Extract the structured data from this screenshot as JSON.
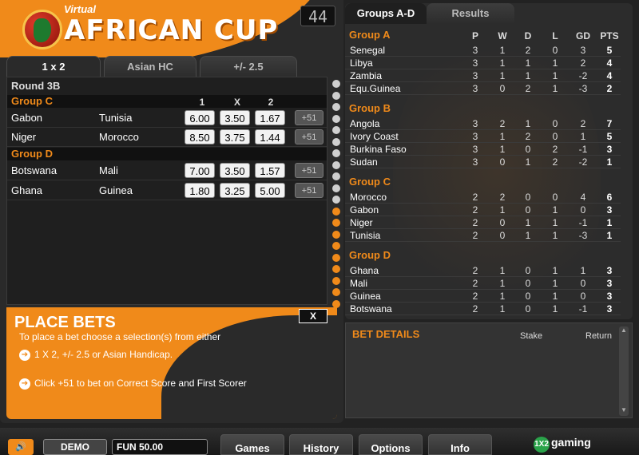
{
  "header": {
    "virtual": "Virtual",
    "title": "AFRICAN CUP",
    "round_counter": "44"
  },
  "tabs_left": [
    {
      "label": "1 x 2",
      "active": true
    },
    {
      "label": "Asian HC",
      "active": false
    },
    {
      "label": "+/- 2.5",
      "active": false
    }
  ],
  "market": {
    "round": "Round 3B",
    "columns": [
      "1",
      "X",
      "2"
    ],
    "plus_label": "+51",
    "groups": [
      {
        "name": "Group C",
        "matches": [
          {
            "home": "Gabon",
            "away": "Tunisia",
            "o1": "6.00",
            "ox": "3.50",
            "o2": "1.67"
          },
          {
            "home": "Niger",
            "away": "Morocco",
            "o1": "8.50",
            "ox": "3.75",
            "o2": "1.44"
          }
        ]
      },
      {
        "name": "Group D",
        "matches": [
          {
            "home": "Botswana",
            "away": "Mali",
            "o1": "7.00",
            "ox": "3.50",
            "o2": "1.57"
          },
          {
            "home": "Ghana",
            "away": "Guinea",
            "o1": "1.80",
            "ox": "3.25",
            "o2": "5.00"
          }
        ]
      }
    ]
  },
  "place_bets": {
    "title": "PLACE BETS",
    "intro": "To place a bet choose a selection(s) from either",
    "line1": "1 X 2, +/- 2.5 or Asian Handicap.",
    "line2": "Click +51 to bet on Correct Score and First Scorer",
    "close": "X"
  },
  "tabs_right": [
    {
      "label": "Groups A-D",
      "active": true
    },
    {
      "label": "Results",
      "active": false
    }
  ],
  "standings": {
    "columns": [
      "P",
      "W",
      "D",
      "L",
      "GD",
      "PTS"
    ],
    "groups": [
      {
        "name": "Group A",
        "rows": [
          [
            "Senegal",
            "3",
            "1",
            "2",
            "0",
            "3",
            "5"
          ],
          [
            "Libya",
            "3",
            "1",
            "1",
            "1",
            "2",
            "4"
          ],
          [
            "Zambia",
            "3",
            "1",
            "1",
            "1",
            "-2",
            "4"
          ],
          [
            "Equ.Guinea",
            "3",
            "0",
            "2",
            "1",
            "-3",
            "2"
          ]
        ]
      },
      {
        "name": "Group B",
        "rows": [
          [
            "Angola",
            "3",
            "2",
            "1",
            "0",
            "2",
            "7"
          ],
          [
            "Ivory Coast",
            "3",
            "1",
            "2",
            "0",
            "1",
            "5"
          ],
          [
            "Burkina Faso",
            "3",
            "1",
            "0",
            "2",
            "-1",
            "3"
          ],
          [
            "Sudan",
            "3",
            "0",
            "1",
            "2",
            "-2",
            "1"
          ]
        ]
      },
      {
        "name": "Group C",
        "rows": [
          [
            "Morocco",
            "2",
            "2",
            "0",
            "0",
            "4",
            "6"
          ],
          [
            "Gabon",
            "2",
            "1",
            "0",
            "1",
            "0",
            "3"
          ],
          [
            "Niger",
            "2",
            "0",
            "1",
            "1",
            "-1",
            "1"
          ],
          [
            "Tunisia",
            "2",
            "0",
            "1",
            "1",
            "-3",
            "1"
          ]
        ]
      },
      {
        "name": "Group D",
        "rows": [
          [
            "Ghana",
            "2",
            "1",
            "0",
            "1",
            "1",
            "3"
          ],
          [
            "Mali",
            "2",
            "1",
            "0",
            "1",
            "0",
            "3"
          ],
          [
            "Guinea",
            "2",
            "1",
            "0",
            "1",
            "0",
            "3"
          ],
          [
            "Botswana",
            "2",
            "1",
            "0",
            "1",
            "-1",
            "3"
          ]
        ]
      }
    ]
  },
  "bet_details": {
    "title": "BET DETAILS",
    "stake": "Stake",
    "return": "Return"
  },
  "bottom": {
    "demo": "DEMO",
    "fun": "FUN 50.00",
    "nav": [
      "Games",
      "History",
      "Options",
      "Info"
    ],
    "brand": "gaming",
    "brand_mark": "1X2"
  }
}
